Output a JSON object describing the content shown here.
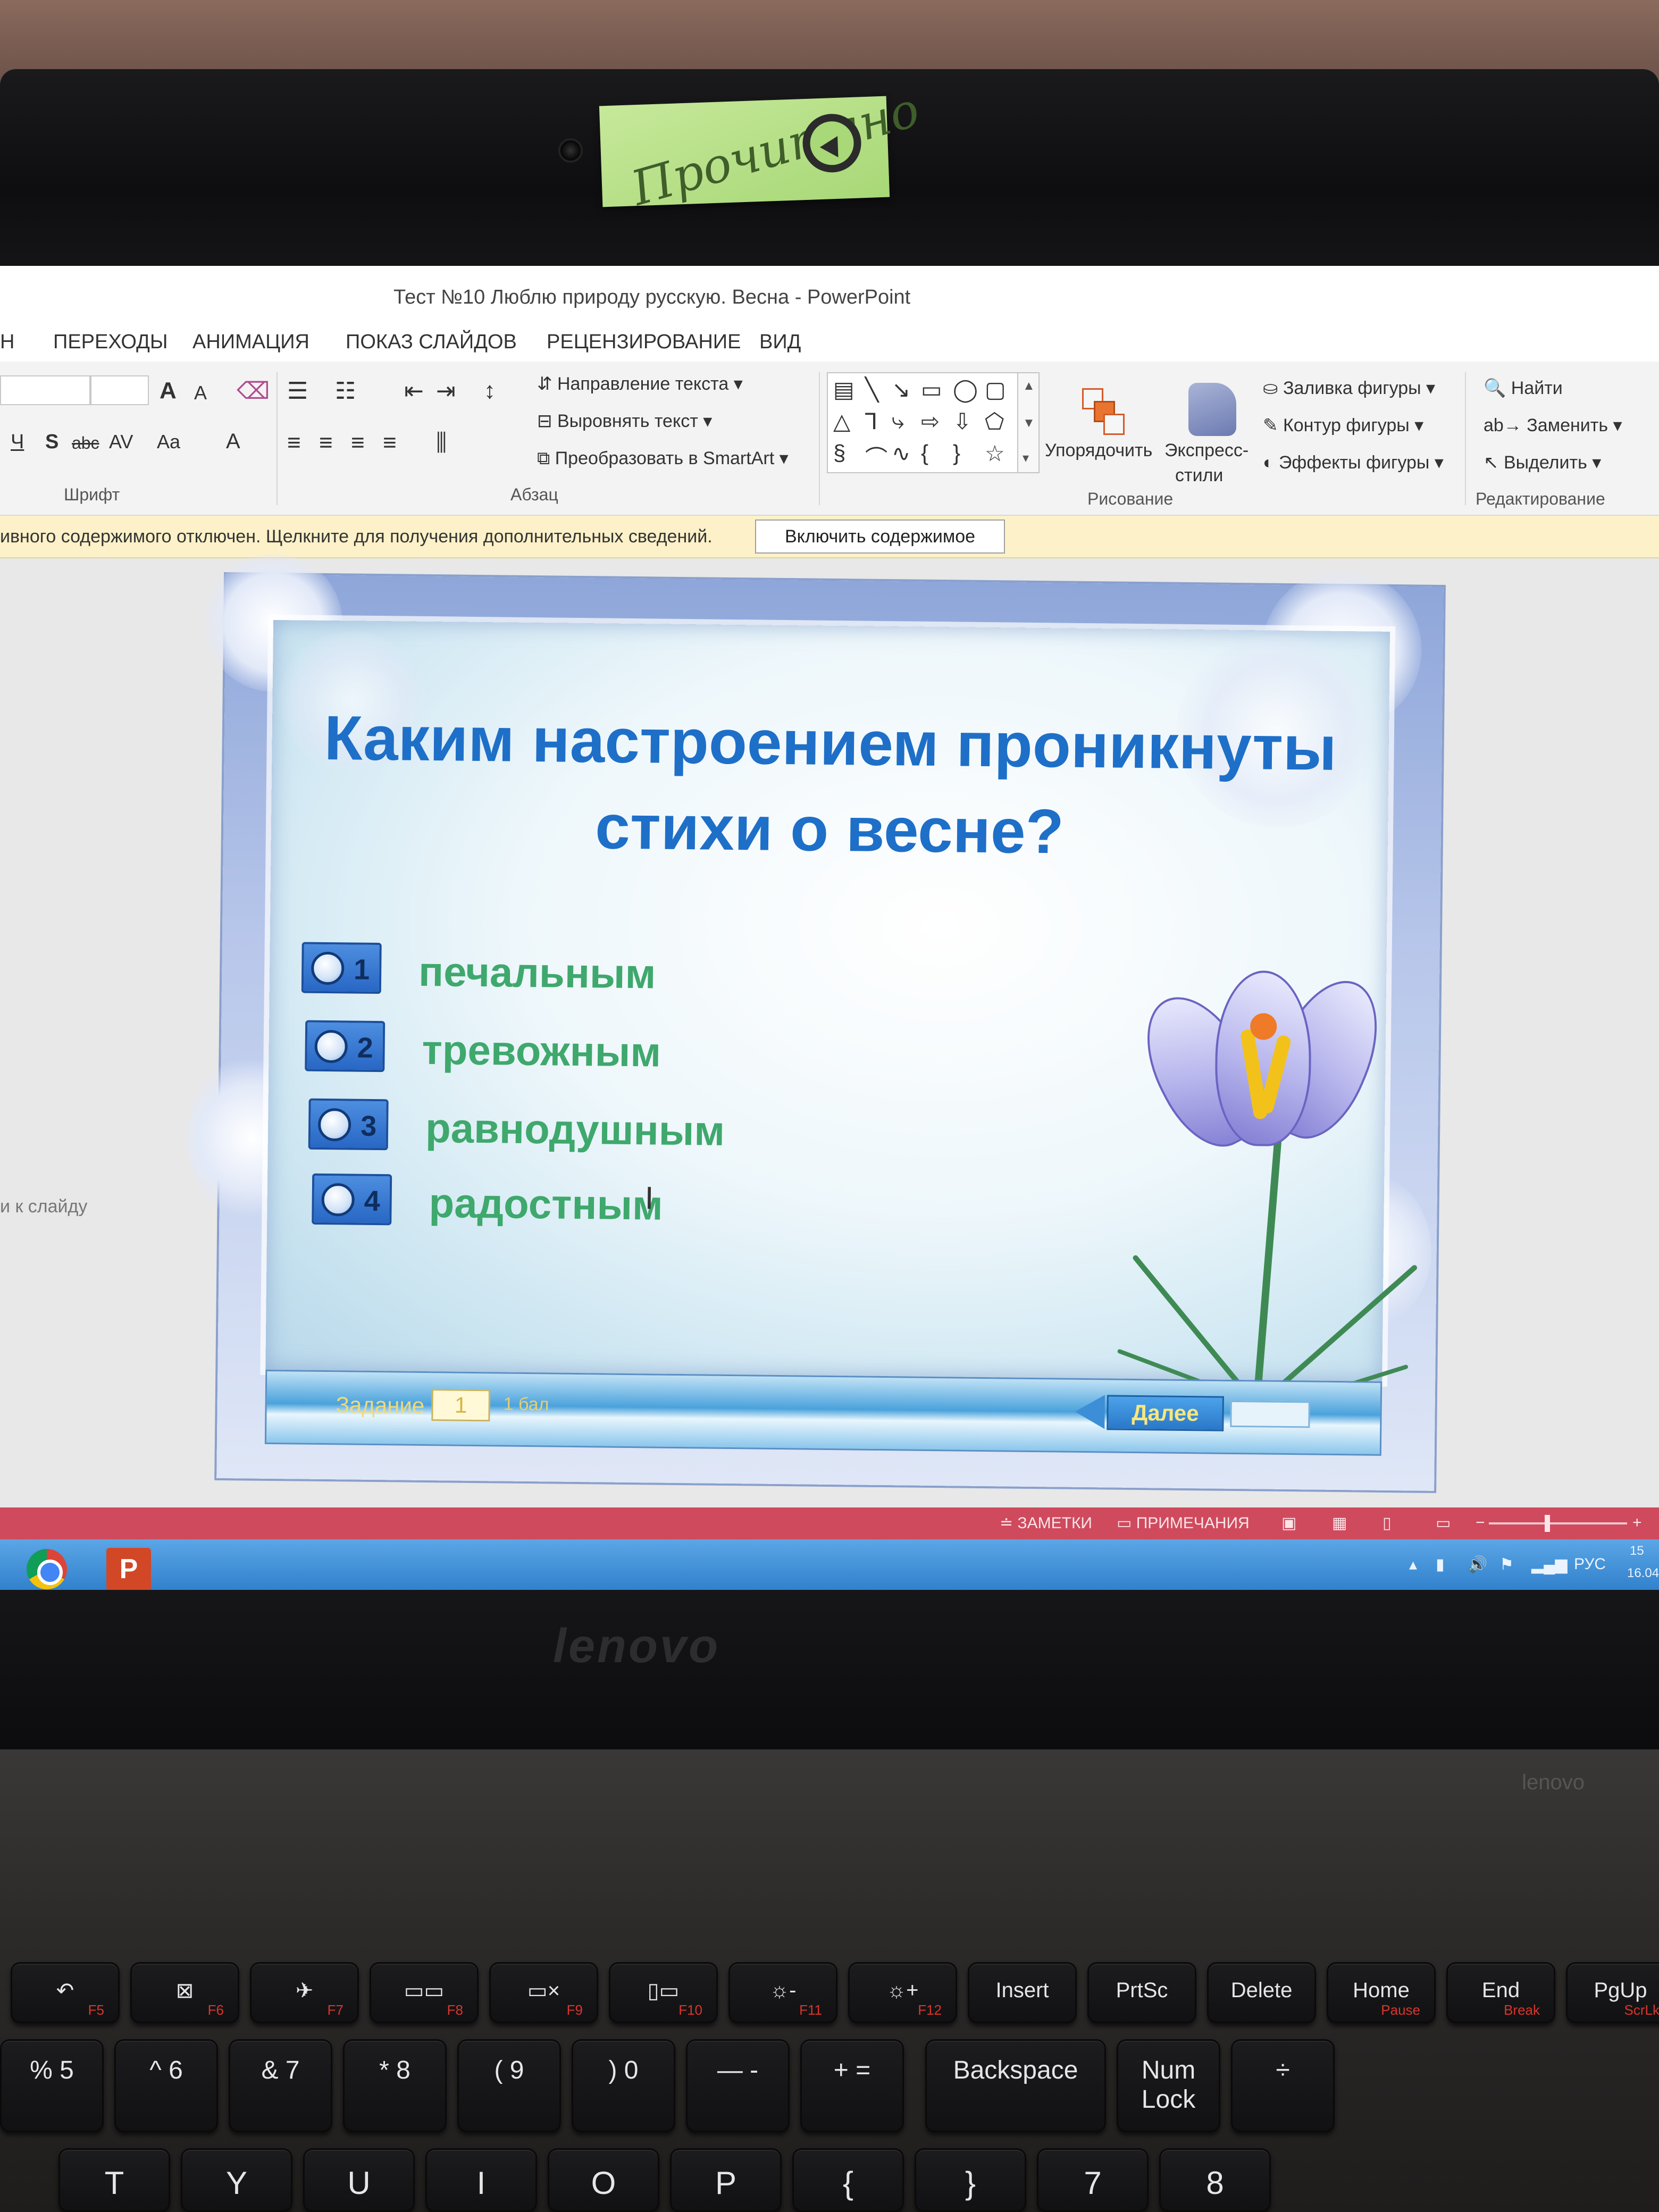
{
  "sticker": {
    "text": "Прочитано"
  },
  "window": {
    "title": "Тест №10 Люблю природу русскую. Весна - PowerPoint"
  },
  "ribbon_tabs": [
    "Н",
    "ПЕРЕХОДЫ",
    "АНИМАЦИЯ",
    "ПОКАЗ СЛАЙДОВ",
    "РЕЦЕНЗИРОВАНИЕ",
    "ВИД"
  ],
  "ribbon": {
    "font_group_label": "Шрифт",
    "paragraph_group_label": "Абзац",
    "drawing_group_label": "Рисование",
    "editing_group_label": "Редактирование",
    "text_direction": "Направление текста",
    "align_text": "Выровнять текст",
    "convert_smartart": "Преобразовать в SmartArt",
    "arrange": "Упорядочить",
    "express_styles_line1": "Экспресс-",
    "express_styles_line2": "стили",
    "shape_fill": "Заливка фигуры",
    "shape_outline": "Контур фигуры",
    "shape_effects": "Эффекты фигуры",
    "find": "Найти",
    "replace": "Заменить",
    "select": "Выделить",
    "font_btn_increase": "A",
    "font_btn_decrease": "A",
    "underline": "Ч",
    "strikeshadow": "S",
    "strike": "abc",
    "spacing": "AV",
    "case": "Aa",
    "font_color": "A"
  },
  "message_bar": {
    "text": "ивного содержимого отключен. Щелкните для получения дополнительных сведений.",
    "button": "Включить содержимое"
  },
  "workspace": {
    "thumb_hint": "и к слайду"
  },
  "slide": {
    "question": "Каким настроением проникнуты стихи о весне?",
    "answers": [
      {
        "num": "1",
        "label": "печальным"
      },
      {
        "num": "2",
        "label": "тревожным"
      },
      {
        "num": "3",
        "label": "равнодушным"
      },
      {
        "num": "4",
        "label": "радостным"
      }
    ],
    "task_label": "Задание",
    "task_number": "1",
    "score_label": "1 бал",
    "next_button": "Далее"
  },
  "status_bar": {
    "notes": "ЗАМЕТКИ",
    "comments": "ПРИМЕЧАНИЯ"
  },
  "taskbar": {
    "ppt_letter": "P",
    "lang": "РУС",
    "time": "15",
    "date": "16.04"
  },
  "keyboard": {
    "fkeys": [
      {
        "main": "↶",
        "sub": "F5"
      },
      {
        "main": "⊠",
        "sub": "F6"
      },
      {
        "main": "✈",
        "sub": "F7"
      },
      {
        "main": "▭▭",
        "sub": "F8"
      },
      {
        "main": "▭×",
        "sub": "F9"
      },
      {
        "main": "▯▭",
        "sub": "F10"
      },
      {
        "main": "☼-",
        "sub": "F11"
      },
      {
        "main": "☼+",
        "sub": "F12"
      },
      {
        "main": "Insert",
        "sub": ""
      },
      {
        "main": "PrtSc",
        "sub": ""
      },
      {
        "main": "Delete",
        "sub": ""
      },
      {
        "main": "Home",
        "sub": "Pause"
      },
      {
        "main": "End",
        "sub": "Break"
      },
      {
        "main": "PgUp",
        "sub": "ScrLk"
      }
    ],
    "numrow": [
      {
        "main": "% 5"
      },
      {
        "main": "^ 6"
      },
      {
        "main": "& 7"
      },
      {
        "main": "* 8"
      },
      {
        "main": "( 9"
      },
      {
        "main": ") 0"
      },
      {
        "main": "— -"
      },
      {
        "main": "+ ="
      },
      {
        "main": "Backspace"
      },
      {
        "main": "Num Lock"
      },
      {
        "main": "÷"
      }
    ],
    "letters": [
      "T",
      "Y",
      "U",
      "I",
      "O",
      "P",
      "{",
      "}",
      "7",
      "8"
    ]
  },
  "brand": {
    "logo": "lenovo",
    "deck_brand": "lenovo"
  }
}
